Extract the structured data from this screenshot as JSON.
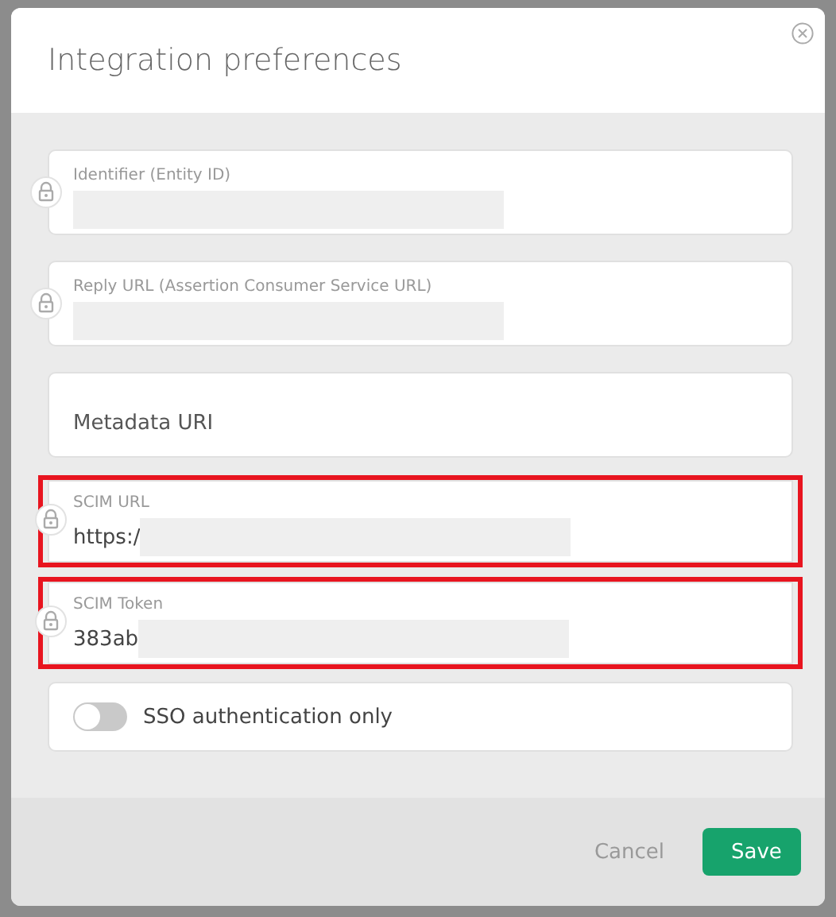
{
  "dialog": {
    "title": "Integration preferences"
  },
  "fields": [
    {
      "kind": "text",
      "label": "Identifier (Entity ID)",
      "locked": true,
      "redacted": true,
      "highlighted": false
    },
    {
      "kind": "text",
      "label": "Reply URL (Assertion Consumer Service URL)",
      "locked": true,
      "redacted": true,
      "highlighted": false
    },
    {
      "kind": "empty",
      "placeholder": "Metadata URI",
      "locked": false,
      "highlighted": false
    },
    {
      "kind": "text",
      "label": "SCIM URL",
      "value": "https:/",
      "locked": true,
      "redacted": true,
      "highlighted": true
    },
    {
      "kind": "text",
      "label": "SCIM Token",
      "value": "383ab",
      "locked": true,
      "redacted": true,
      "highlighted": true
    }
  ],
  "toggle": {
    "label": "SSO authentication only",
    "on": false
  },
  "buttons": [
    {
      "kind": "secondary",
      "label": "Cancel"
    },
    {
      "kind": "primary",
      "label": "Save"
    }
  ]
}
